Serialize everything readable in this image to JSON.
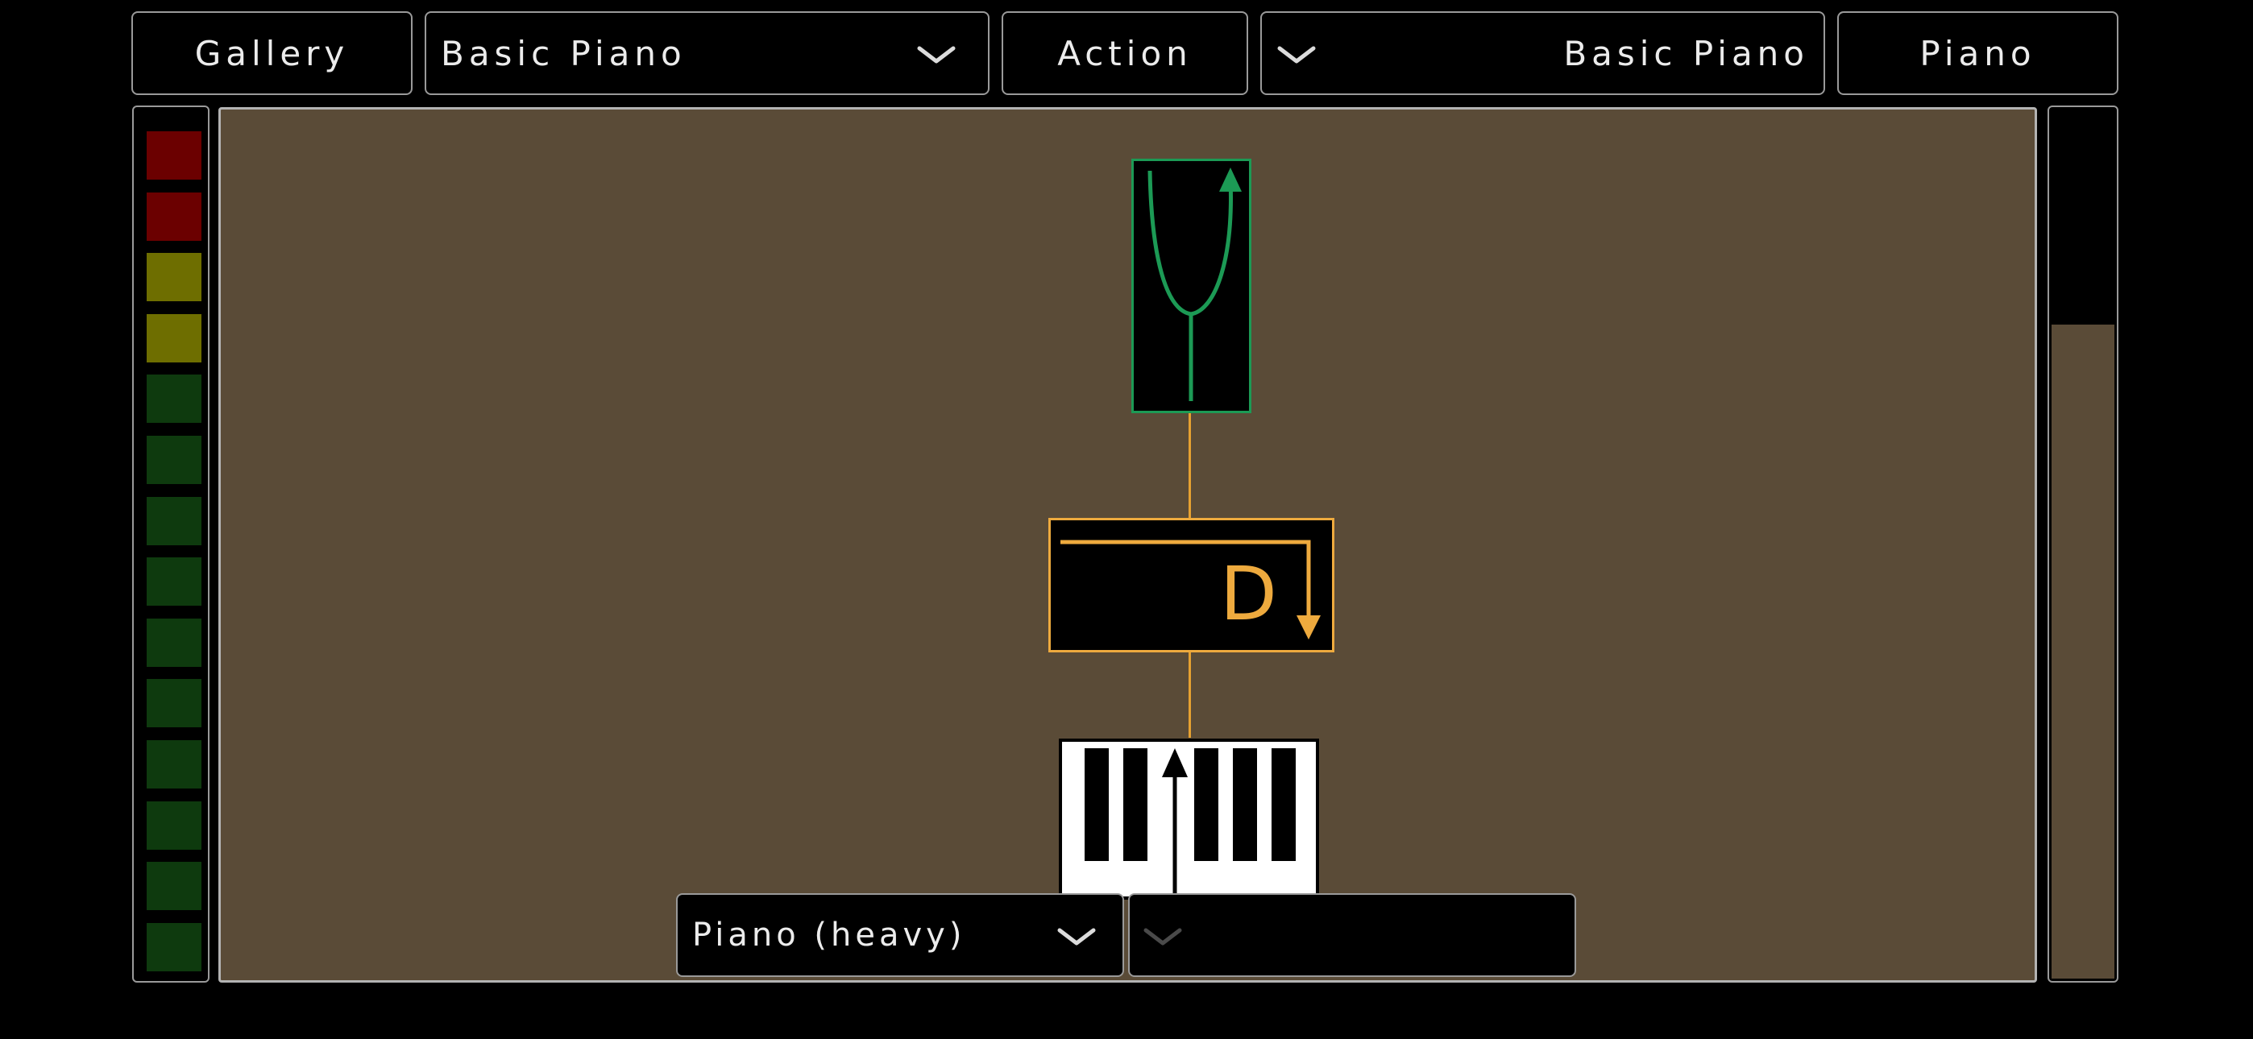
{
  "toolbar": {
    "gallery_label": "Gallery",
    "preset_left": "Basic Piano",
    "action_label": "Action",
    "preset_right": "Basic Piano",
    "instrument_label": "Piano"
  },
  "meter": {
    "segments": [
      "#6b0000",
      "#6b0000",
      "#6e6e00",
      "#6e6e00",
      "#0e3a0e",
      "#0e3a0e",
      "#0e3a0e",
      "#0e3a0e",
      "#0e3a0e",
      "#0e3a0e",
      "#0e3a0e",
      "#0e3a0e",
      "#0e3a0e",
      "#0e3a0e"
    ]
  },
  "canvas": {
    "background": "#5a4b37",
    "nodes": {
      "tuner": {
        "icon": "tuning-fork-icon",
        "color": "#1c9a55"
      },
      "delay": {
        "icon": "delay-icon",
        "label": "D",
        "color": "#eeaa3e"
      },
      "keyboard": {
        "icon": "piano-keys-icon"
      }
    }
  },
  "bottom_bar": {
    "sound_select": "Piano (heavy)",
    "second_select": ""
  },
  "slider": {
    "level": 0.75
  }
}
